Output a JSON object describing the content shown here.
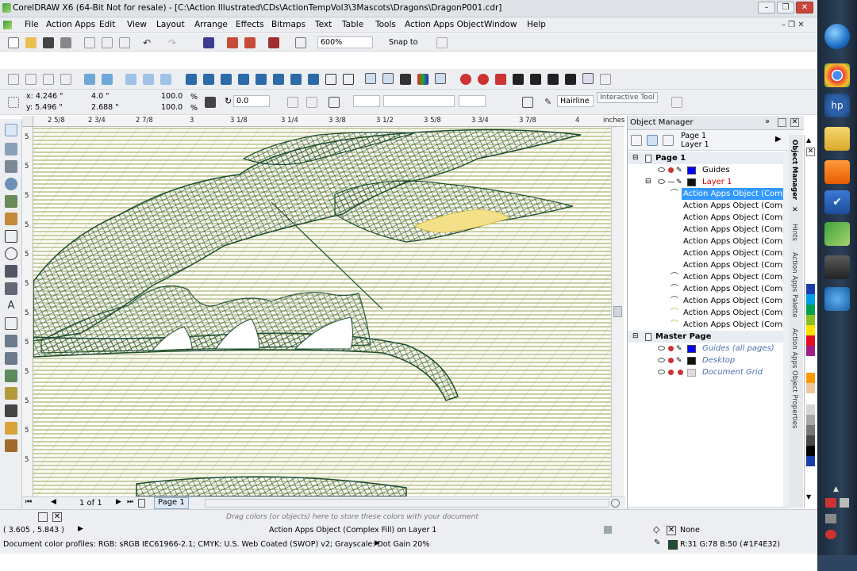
{
  "window": {
    "title": "CorelDRAW X6 (64-Bit Not for resale) - [C:\\Action Illustrated\\CDs\\ActionTempVol3\\3Mascots\\Dragons\\DragonP001.cdr]"
  },
  "menu": [
    "File",
    "Action Apps",
    "Edit",
    "View",
    "Layout",
    "Arrange",
    "Effects",
    "Bitmaps",
    "Text",
    "Table",
    "Tools",
    "Action Apps Object",
    "Window",
    "Help"
  ],
  "standard_toolbar": {
    "zoom": "600%",
    "snap_to": "Snap to"
  },
  "property_bar": {
    "x": "x: 4.246 \"",
    "y": "y: 5.496 \"",
    "w": "4.0 \"",
    "h": "2.688 \"",
    "scale_w": "100.0",
    "scale_h": "100.0",
    "rotation": "0.0",
    "percent": "%",
    "outline": "Hairline"
  },
  "tooltip": "Interactive Tool",
  "rulers": {
    "units": "inches",
    "h_ticks": [
      "2 5/8",
      "2 3/4",
      "2 7/8",
      "3",
      "3 1/8",
      "3 1/4",
      "3 3/8",
      "3 1/2",
      "3 5/8",
      "3 3/4",
      "3 7/8",
      "4"
    ],
    "v_ticks": [
      "5",
      "5",
      "5",
      "5",
      "5",
      "5",
      "5",
      "5",
      "5",
      "5",
      "5",
      "5"
    ]
  },
  "page_nav": {
    "counter": "1 of 1",
    "tab": "Page 1"
  },
  "object_manager": {
    "title": "Object Manager",
    "header_page": "Page 1",
    "header_layer": "Layer 1",
    "page": "Page 1",
    "guides": "Guides",
    "layer": "Layer 1",
    "objects": [
      "Action Apps Object (Comple",
      "Action Apps Object (Comple",
      "Action Apps Object (Comple",
      "Action Apps Object (Comple",
      "Action Apps Object (Comple",
      "Action Apps Object (Comple",
      "Action Apps Object (Comple",
      "Action Apps Object (Comple",
      "Action Apps Object (Comple",
      "Action Apps Object (Comple",
      "Action Apps Object (Comple",
      "Action Apps Object (Comple"
    ],
    "master_page": "Master Page",
    "master_layers": [
      "Guides (all pages)",
      "Desktop",
      "Document Grid"
    ]
  },
  "docker_tabs": [
    "Object Manager",
    "Hints",
    "Action Apps Palette",
    "Action Apps Object Properties"
  ],
  "status": {
    "hint": "Drag colors (or objects) here to store these colors with your document",
    "coords": "( 3.605 , 5.843 )",
    "selection": "Action Apps Object (Complex Fill) on Layer 1",
    "fill": "None",
    "outline_color": "R:31 G:78 B:50 (#1F4E32)",
    "profiles": "Document color profiles: RGB: sRGB IEC61966-2.1; CMYK: U.S. Web Coated (SWOP) v2; Grayscale: Dot Gain 20%"
  },
  "colors": {
    "accent_select": "#3399ff",
    "layer_red": "#e00000",
    "outline": "#1F4E32",
    "hatch": "#7a8a1e",
    "fill_yellow": "#f5e08a"
  },
  "palette": [
    "#ffffff",
    "#000000",
    "#1a3fa8",
    "#00a0e0",
    "#00a050",
    "#88c020",
    "#ffe000",
    "#ff9900",
    "#e01020",
    "#a0208a",
    "#d4d4d4",
    "#a8a8a8",
    "#787878",
    "#484848",
    "#f0c8a0",
    "#c08850"
  ]
}
